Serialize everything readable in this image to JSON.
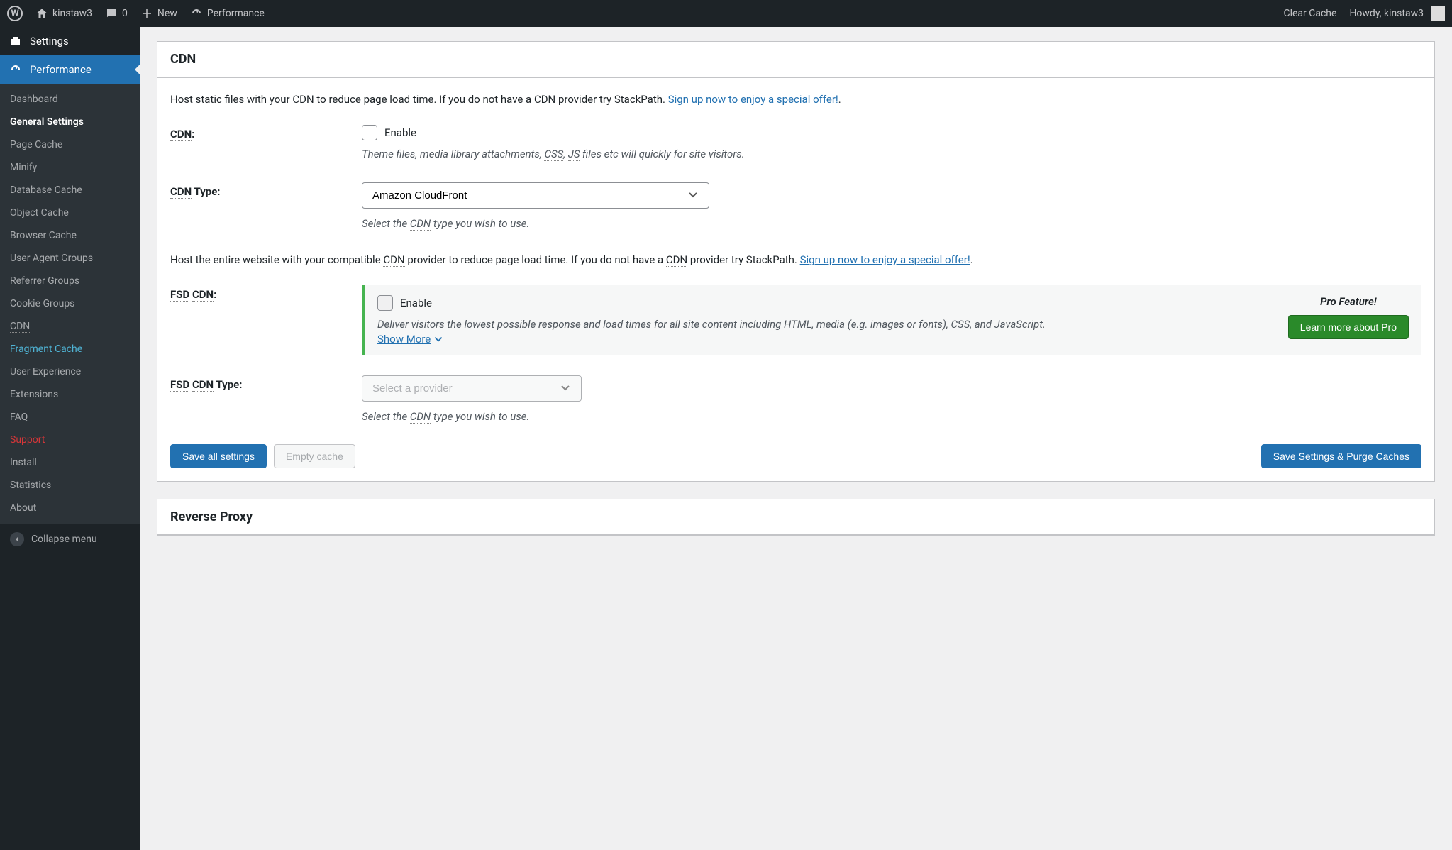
{
  "adminbar": {
    "site_name": "kinstaw3",
    "comments_count": "0",
    "new_label": "New",
    "performance_label": "Performance",
    "clear_cache": "Clear Cache",
    "howdy": "Howdy, kinstaw3"
  },
  "sidebar": {
    "settings_label": "Settings",
    "performance_label": "Performance",
    "collapse_label": "Collapse menu",
    "items": [
      {
        "label": "Dashboard"
      },
      {
        "label": "General Settings"
      },
      {
        "label": "Page Cache"
      },
      {
        "label": "Minify"
      },
      {
        "label": "Database Cache"
      },
      {
        "label": "Object Cache"
      },
      {
        "label": "Browser Cache"
      },
      {
        "label": "User Agent Groups"
      },
      {
        "label": "Referrer Groups"
      },
      {
        "label": "Cookie Groups"
      },
      {
        "label": "CDN"
      },
      {
        "label": "Fragment Cache"
      },
      {
        "label": "User Experience"
      },
      {
        "label": "Extensions"
      },
      {
        "label": "FAQ"
      },
      {
        "label": "Support"
      },
      {
        "label": "Install"
      },
      {
        "label": "Statistics"
      },
      {
        "label": "About"
      }
    ]
  },
  "cdn": {
    "heading": "CDN",
    "intro_pre": "Host static files with your ",
    "intro_mid": " to reduce page load time. If you do not have a ",
    "intro_post": " provider try StackPath. ",
    "cdn_abbr": "CDN",
    "signup_link": "Sign up now to enjoy a special offer!",
    "dot": ".",
    "field_label_pre": "CDN",
    "field_label_post": ":",
    "enable_label": "Enable",
    "enable_desc_pre": "Theme files, media library attachments, ",
    "enable_desc_css": "CSS",
    "enable_desc_comma": ", ",
    "enable_desc_js": "JS",
    "enable_desc_post": " files etc will quickly for site visitors.",
    "type_label_pre": "CDN",
    "type_label_post": " Type:",
    "type_value": "Amazon CloudFront",
    "type_desc_pre": "Select the ",
    "type_desc_post": " type you wish to use.",
    "fsd_intro_pre": "Host the entire website with your compatible ",
    "fsd_intro_mid": " provider to reduce page load time. If you do not have a ",
    "fsd_intro_post": " provider try StackPath. ",
    "fsd_label_pre": "FSD",
    "fsd_enable_label": "Enable",
    "fsd_desc": "Deliver visitors the lowest possible response and load times for all site content including HTML, media (e.g. images or fonts), CSS, and JavaScript.",
    "show_more": "Show More",
    "pro_title": "Pro Feature!",
    "pro_button": "Learn more about Pro",
    "fsd_type_label_post": " Type:",
    "fsd_type_placeholder": "Select a provider",
    "save_all": "Save all settings",
    "empty_cache": "Empty cache",
    "save_purge": "Save Settings & Purge Caches"
  },
  "reverse_proxy": {
    "heading": "Reverse Proxy"
  }
}
